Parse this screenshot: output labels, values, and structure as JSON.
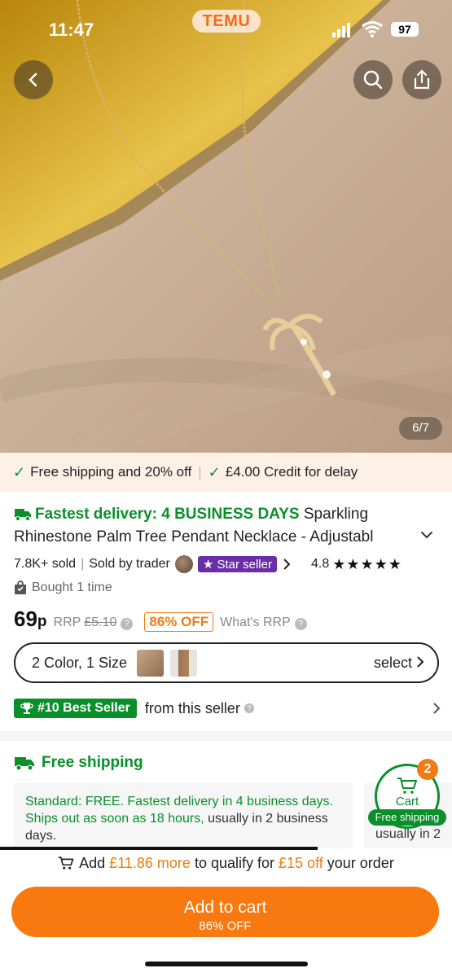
{
  "status_bar": {
    "time": "11:47",
    "app_badge": "TEMU",
    "battery": "97"
  },
  "hero": {
    "image_counter": "6/7"
  },
  "promo": {
    "free_shipping": "Free shipping and 20% off",
    "credit": "£4.00 Credit for delay"
  },
  "product": {
    "delivery_label": "Fastest delivery: 4 BUSINESS DAYS",
    "title_part1": "Sparkling",
    "title_line2": "Rhinestone Palm Tree Pendant Necklace - Adjustabl",
    "sold": "7.8K+ sold",
    "sold_by": "Sold by trader",
    "star_seller": "Star seller",
    "rating": "4.8",
    "stars": "★★★★★",
    "bought": "Bought 1 time",
    "price": "69",
    "price_unit": "p",
    "rrp_label": "RRP",
    "rrp_value": "£5.10",
    "discount": "86% OFF",
    "whats_rrp": "What's RRP",
    "variant_text": "2 Color, 1 Size",
    "variant_select": "select",
    "best_seller": "#10 Best Seller",
    "best_from": "from this seller"
  },
  "shipping": {
    "title": "Free shipping",
    "standard": "Standard: FREE.",
    "fastest": "Fastest delivery in 4 business days.",
    "ships_out": "Ships out as soon as 18 hours,",
    "usually": "usually in 2 business days.",
    "card2_text": "usually in 2"
  },
  "cart_float": {
    "label": "Cart",
    "count": "2",
    "tag": "Free shipping"
  },
  "bottom": {
    "qualify_pre": "Add",
    "qualify_amount": "£11.86 more",
    "qualify_mid": "to qualify for",
    "qualify_off": "£15 off",
    "qualify_post": "your order",
    "add_to_cart": "Add to cart",
    "add_to_cart_sub": "86% OFF"
  },
  "colors": {
    "accent": "#f7790f",
    "green": "#0a8f2a",
    "star_seller": "#6a2ea8"
  }
}
